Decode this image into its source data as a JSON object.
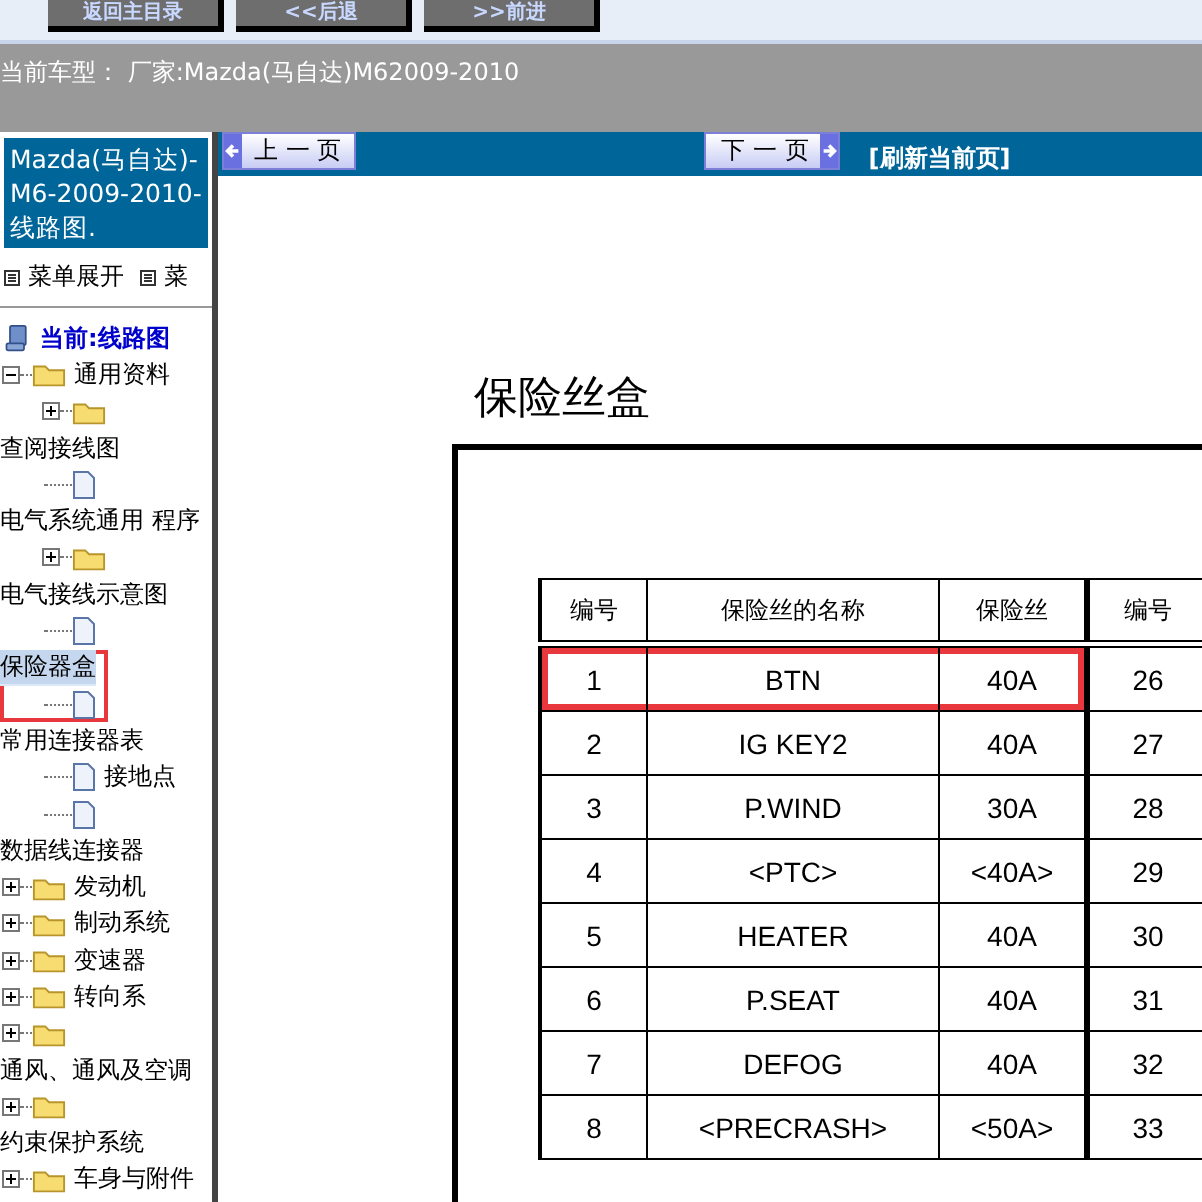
{
  "top_buttons": [
    "返回主目录",
    "<<后退",
    ">>前进"
  ],
  "vehicle_line": "当前车型：  厂家:Mazda(马自达)M62009-2010",
  "sidebar": {
    "header": "Mazda(马自达)-M6-2009-2010- 线路图.",
    "menu_links": [
      "菜单展开",
      "菜"
    ],
    "tree": [
      {
        "kind": "root",
        "text": "当前:线路图",
        "selected": false,
        "outlined": false
      },
      {
        "kind": "folder",
        "text": "通用资料",
        "expanded": true,
        "selected": false,
        "outlined": false,
        "children": [
          {
            "kind": "folder",
            "expanded": false
          }
        ]
      },
      {
        "kind": "caption",
        "text": "查阅接线图",
        "selected": false,
        "outlined": false,
        "children": [
          {
            "kind": "doc"
          }
        ]
      },
      {
        "kind": "caption",
        "text": "电气系统通用 程序",
        "selected": false,
        "outlined": false,
        "children": [
          {
            "kind": "folder",
            "expanded": false
          }
        ]
      },
      {
        "kind": "caption",
        "text": "电气接线示意图",
        "selected": false,
        "outlined": false,
        "children": [
          {
            "kind": "doc"
          }
        ]
      },
      {
        "kind": "caption",
        "text": "保险器盒",
        "selected": true,
        "outlined": true,
        "children": [
          {
            "kind": "doc"
          }
        ]
      },
      {
        "kind": "caption",
        "text": "常用连接器表",
        "selected": false,
        "outlined": false,
        "children": [
          {
            "kind": "doc",
            "text": "接地点"
          },
          {
            "kind": "doc"
          }
        ]
      },
      {
        "kind": "caption",
        "text": "数据线连接器",
        "selected": false,
        "outlined": false
      },
      {
        "kind": "folder",
        "text": "发动机",
        "expanded": false,
        "selected": false,
        "outlined": false
      },
      {
        "kind": "folder",
        "text": "制动系统",
        "expanded": false,
        "selected": false,
        "outlined": false
      },
      {
        "kind": "folder",
        "text": "变速器",
        "expanded": false,
        "selected": false,
        "outlined": false
      },
      {
        "kind": "folder",
        "text": "转向系",
        "expanded": false,
        "selected": false,
        "outlined": false
      },
      {
        "kind": "folder",
        "expanded": false,
        "selected": false,
        "outlined": false
      },
      {
        "kind": "caption",
        "text": "通风、通风及空调",
        "selected": false,
        "outlined": false
      },
      {
        "kind": "folder",
        "expanded": false,
        "selected": false,
        "outlined": false
      },
      {
        "kind": "caption",
        "text": "约束保护系统",
        "selected": false,
        "outlined": false
      },
      {
        "kind": "folder",
        "text": "车身与附件",
        "expanded": false,
        "selected": false,
        "outlined": false
      }
    ]
  },
  "nav": {
    "prev": "上 一 页",
    "next": "下 一 页",
    "refresh": "[刷新当前页]"
  },
  "page": {
    "title": "保险丝盒",
    "table": {
      "columns": [
        "编号",
        "保险丝的名称",
        "保险丝",
        "编号"
      ],
      "rows": [
        {
          "cells": [
            "1",
            "BTN",
            "40A",
            "26"
          ],
          "outlined": true
        },
        {
          "cells": [
            "2",
            "IG KEY2",
            "40A",
            "27"
          ],
          "outlined": false
        },
        {
          "cells": [
            "3",
            "P.WIND",
            "30A",
            "28"
          ],
          "outlined": false
        },
        {
          "cells": [
            "4",
            "<PTC>",
            "<40A>",
            "29"
          ],
          "outlined": false
        },
        {
          "cells": [
            "5",
            "HEATER",
            "40A",
            "30"
          ],
          "outlined": false
        },
        {
          "cells": [
            "6",
            "P.SEAT",
            "40A",
            "31"
          ],
          "outlined": false
        },
        {
          "cells": [
            "7",
            "DEFOG",
            "40A",
            "32"
          ],
          "outlined": false
        },
        {
          "cells": [
            "8",
            "<PRECRASH>",
            "<50A>",
            "33"
          ],
          "outlined": false
        }
      ]
    }
  }
}
